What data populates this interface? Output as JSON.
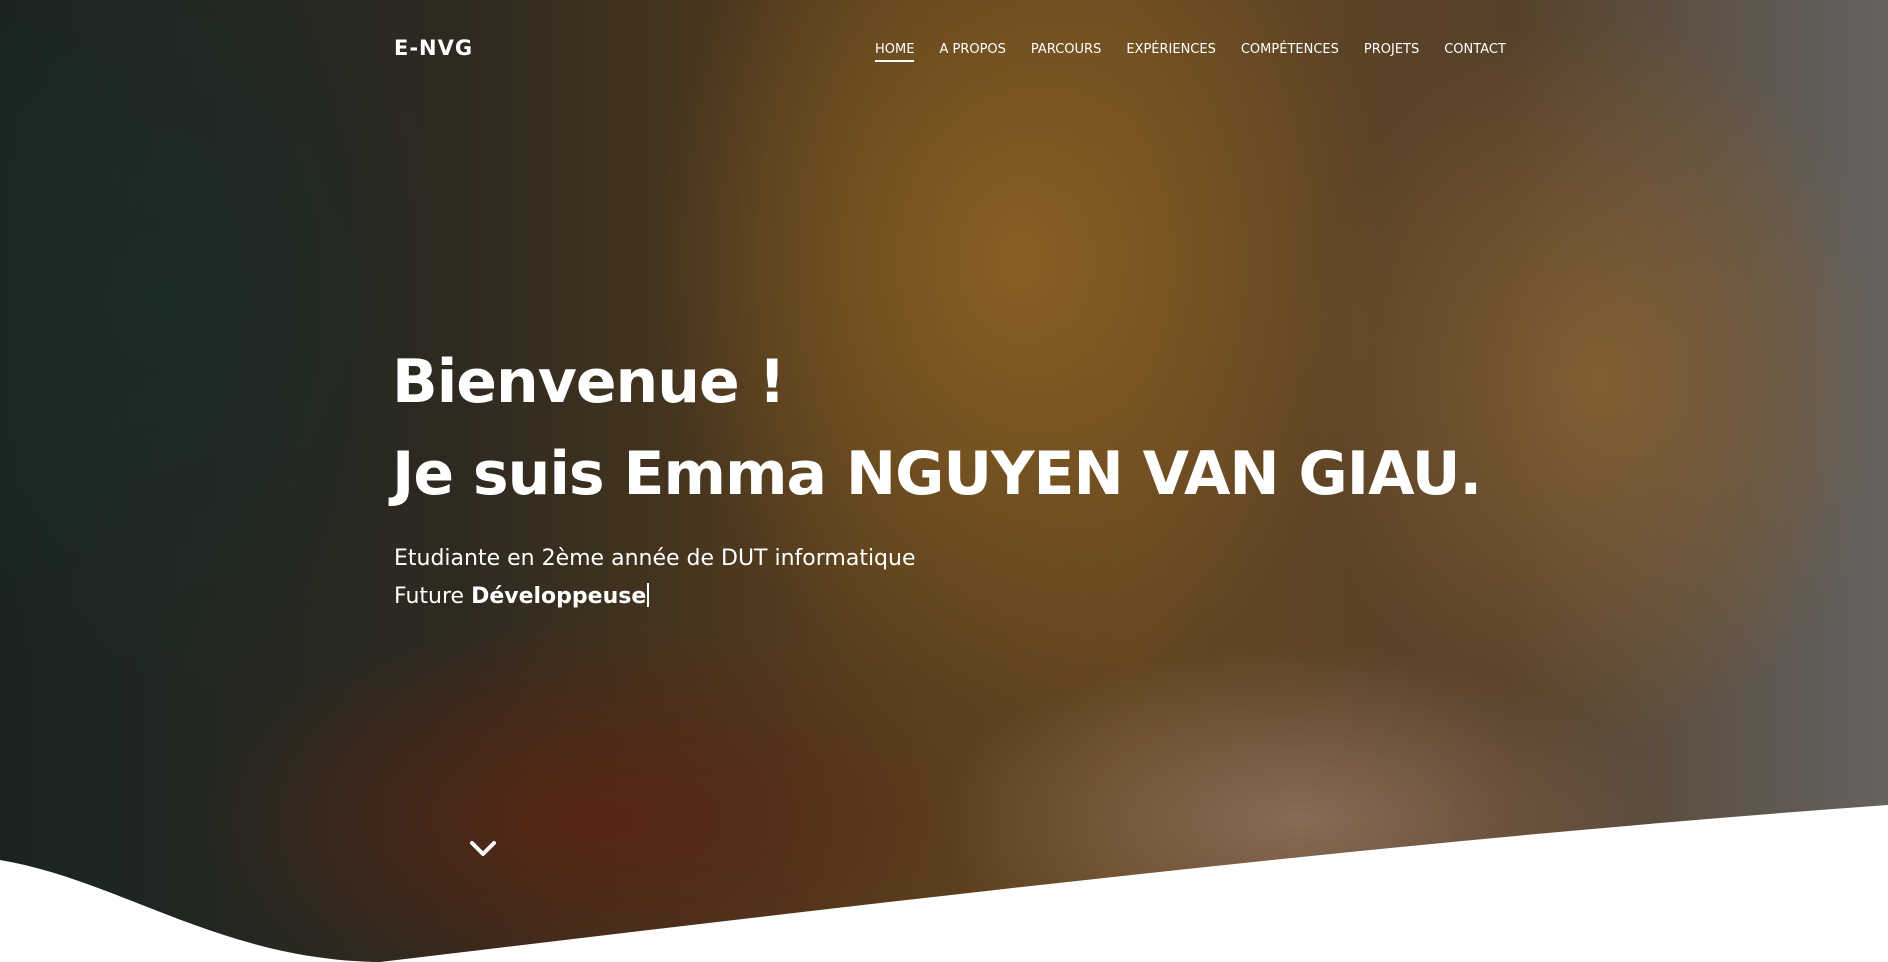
{
  "header": {
    "brand": "E-NVG",
    "nav": [
      {
        "label": "HOME",
        "active": true
      },
      {
        "label": "A PROPOS"
      },
      {
        "label": "PARCOURS"
      },
      {
        "label": "EXPÉRIENCES"
      },
      {
        "label": "COMPÉTENCES"
      },
      {
        "label": "PROJETS"
      },
      {
        "label": "CONTACT"
      }
    ]
  },
  "hero": {
    "line1": "Bienvenue !",
    "line2": "Je suis Emma NGUYEN VAN GIAU.",
    "description": "Etudiante en 2ème année de DUT informatique",
    "role_prefix": "Future",
    "role_typed": "Développeuse",
    "scroll_icon": "chevron-down-icon"
  },
  "colors": {
    "text": "#ffffff",
    "wave": "#ffffff"
  }
}
